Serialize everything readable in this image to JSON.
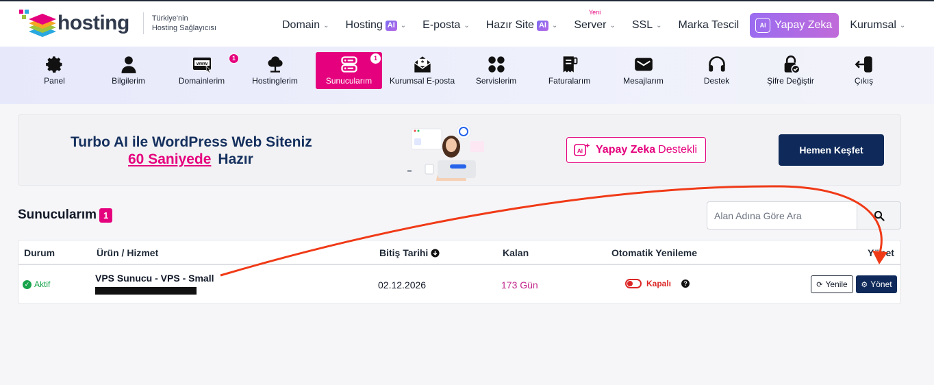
{
  "header": {
    "logo_text": "hosting",
    "logo_tagline_1": "Türkiye'nin",
    "logo_tagline_2": "Hosting Sağlayıcısı",
    "nav": [
      {
        "label": "Domain"
      },
      {
        "label": "Hosting",
        "badge": "AI"
      },
      {
        "label": "E-posta"
      },
      {
        "label": "Hazır Site",
        "badge": "AI"
      },
      {
        "label": "Server",
        "tag": "Yeni"
      },
      {
        "label": "SSL"
      },
      {
        "label": "Marka Tescil"
      },
      {
        "label": "Yapay Zeka",
        "icon_text": "AI"
      },
      {
        "label": "Kurumsal"
      }
    ]
  },
  "panel_nav": {
    "items": [
      {
        "label": "Panel",
        "icon": "gear-icon"
      },
      {
        "label": "Bilgilerim",
        "icon": "user-icon"
      },
      {
        "label": "Domainlerim",
        "icon": "www-browser-icon",
        "badge": "1"
      },
      {
        "label": "Hostinglerim",
        "icon": "cloud-tree-icon"
      },
      {
        "label": "Sunucularım",
        "icon": "server-icon",
        "badge": "1",
        "active": true
      },
      {
        "label": "Kurumsal E-posta",
        "icon": "mail-open-icon"
      },
      {
        "label": "Servislerim",
        "icon": "grid-icon"
      },
      {
        "label": "Faturalarım",
        "icon": "invoice-icon"
      },
      {
        "label": "Mesajlarım",
        "icon": "envelope-icon"
      },
      {
        "label": "Destek",
        "icon": "headset-icon"
      },
      {
        "label": "Şifre Değiştir",
        "icon": "lock-icon"
      },
      {
        "label": "Çıkış",
        "icon": "logout-icon"
      }
    ]
  },
  "banner": {
    "title": "Turbo AI ile WordPress Web Siteniz",
    "highlight": "60 Saniyede",
    "suffix": "Hazır",
    "ai_label_bold": "Yapay Zeka",
    "ai_label_rest": "Destekli",
    "ai_icon_text": "AI",
    "cta": "Hemen Keşfet"
  },
  "section": {
    "title": "Sunucularım",
    "count": "1",
    "search_placeholder": "Alan Adına Göre Ara"
  },
  "table": {
    "columns": {
      "status": "Durum",
      "product": "Ürün / Hizmet",
      "end_date": "Bitiş Tarihi",
      "remaining": "Kalan",
      "auto_renew": "Otomatik Yenileme",
      "manage": "Yönet"
    },
    "rows": [
      {
        "status": "Aktif",
        "product": "VPS Sunucu - VPS - Small",
        "end_date": "02.12.2026",
        "remaining": "173 Gün",
        "auto_renew": "Kapalı",
        "renew_btn": "Yenile",
        "manage_btn": "Yönet"
      }
    ]
  },
  "colors": {
    "accent": "#e5007d",
    "navy": "#0f2a5a",
    "annotation_arrow": "#f03a17"
  }
}
